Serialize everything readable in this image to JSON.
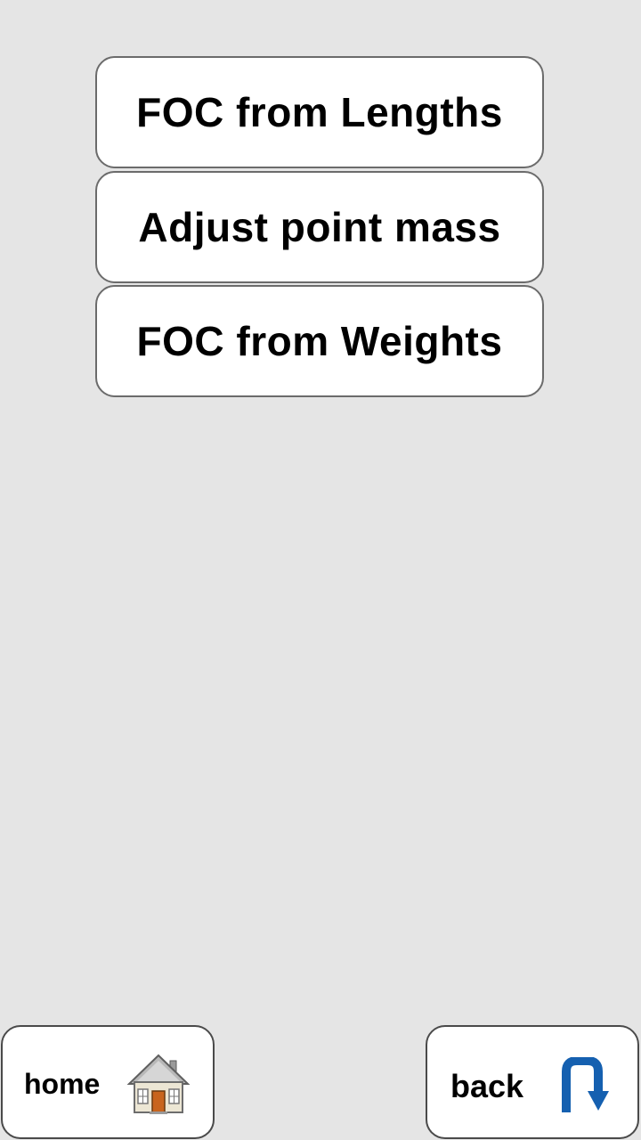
{
  "menu": {
    "items": [
      {
        "label": "FOC from Lengths"
      },
      {
        "label": "Adjust point mass"
      },
      {
        "label": "FOC from Weights"
      }
    ]
  },
  "nav": {
    "home_label": "home",
    "home_icon": "house-icon",
    "back_label": "back",
    "back_icon": "u-turn-arrow-icon"
  },
  "colors": {
    "background": "#e5e5e5",
    "button_fill": "#ffffff",
    "button_border": "#6b6b6b",
    "back_icon": "#1560b0",
    "house_door": "#c8641e"
  }
}
